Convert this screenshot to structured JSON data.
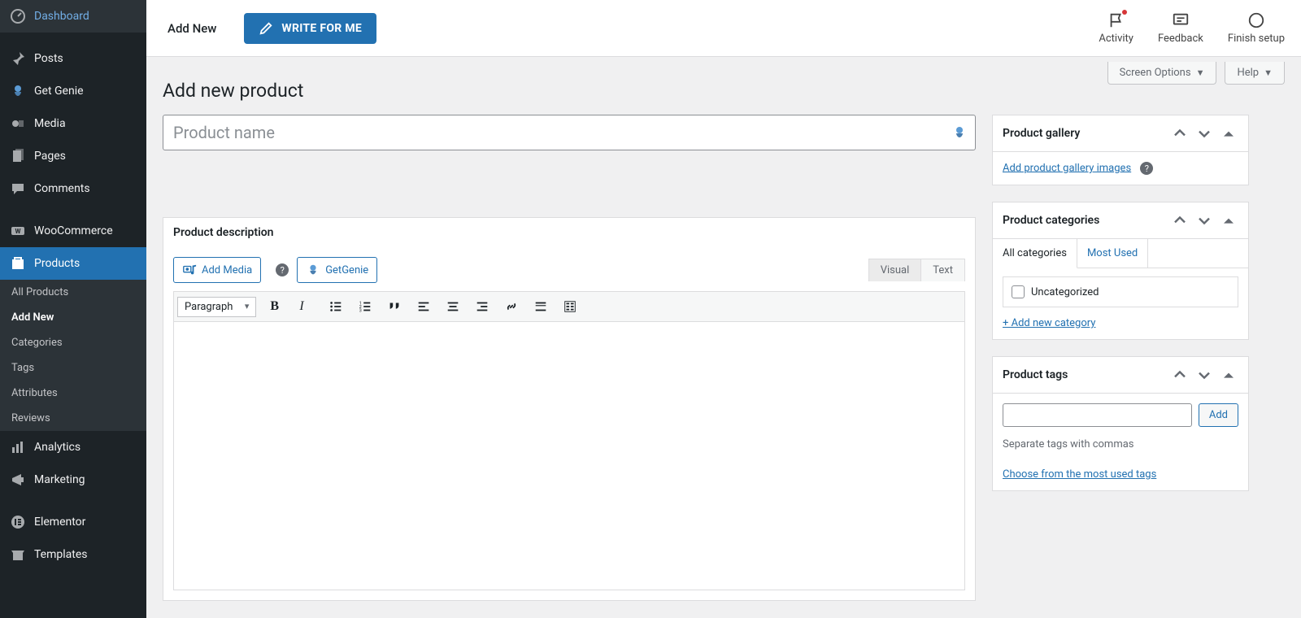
{
  "sidebar": {
    "items": [
      {
        "label": "Dashboard",
        "icon": "dashboard-icon"
      },
      {
        "label": "Posts",
        "icon": "pin-icon"
      },
      {
        "label": "Get Genie",
        "icon": "genie-icon"
      },
      {
        "label": "Media",
        "icon": "media-icon"
      },
      {
        "label": "Pages",
        "icon": "pages-icon"
      },
      {
        "label": "Comments",
        "icon": "comments-icon"
      },
      {
        "label": "WooCommerce",
        "icon": "woocommerce-icon"
      },
      {
        "label": "Products",
        "icon": "products-icon",
        "active": true
      },
      {
        "label": "Analytics",
        "icon": "analytics-icon"
      },
      {
        "label": "Marketing",
        "icon": "marketing-icon"
      },
      {
        "label": "Elementor",
        "icon": "elementor-icon"
      },
      {
        "label": "Templates",
        "icon": "templates-icon"
      }
    ],
    "submenu": [
      {
        "label": "All Products"
      },
      {
        "label": "Add New",
        "current": true
      },
      {
        "label": "Categories"
      },
      {
        "label": "Tags"
      },
      {
        "label": "Attributes"
      },
      {
        "label": "Reviews"
      }
    ]
  },
  "topbar": {
    "title": "Add New",
    "write_button": "WRITE FOR ME",
    "actions": [
      {
        "label": "Activity",
        "icon": "flag-icon",
        "dot": true
      },
      {
        "label": "Feedback",
        "icon": "chat-icon"
      },
      {
        "label": "Finish setup",
        "icon": "circle-icon"
      }
    ]
  },
  "screen_options": {
    "screen": "Screen Options",
    "help": "Help"
  },
  "page": {
    "title": "Add new product"
  },
  "product_name": {
    "placeholder": "Product name"
  },
  "editor": {
    "panel_title": "Product description",
    "add_media": "Add Media",
    "get_genie": "GetGenie",
    "tab_visual": "Visual",
    "tab_text": "Text",
    "format": "Paragraph",
    "toolbar_buttons": [
      "bold",
      "italic",
      "bulleted-list",
      "numbered-list",
      "blockquote",
      "align-left",
      "align-center",
      "align-right",
      "insert-link",
      "insert-more",
      "toggle-toolbar"
    ]
  },
  "gallery": {
    "title": "Product gallery",
    "link": "Add product gallery images"
  },
  "categories": {
    "title": "Product categories",
    "tabs": {
      "all": "All categories",
      "most": "Most Used"
    },
    "items": [
      {
        "label": "Uncategorized",
        "checked": false
      }
    ],
    "add_link": "+ Add new category"
  },
  "tags": {
    "title": "Product tags",
    "add_button": "Add",
    "hint": "Separate tags with commas",
    "choose_link": "Choose from the most used tags"
  }
}
